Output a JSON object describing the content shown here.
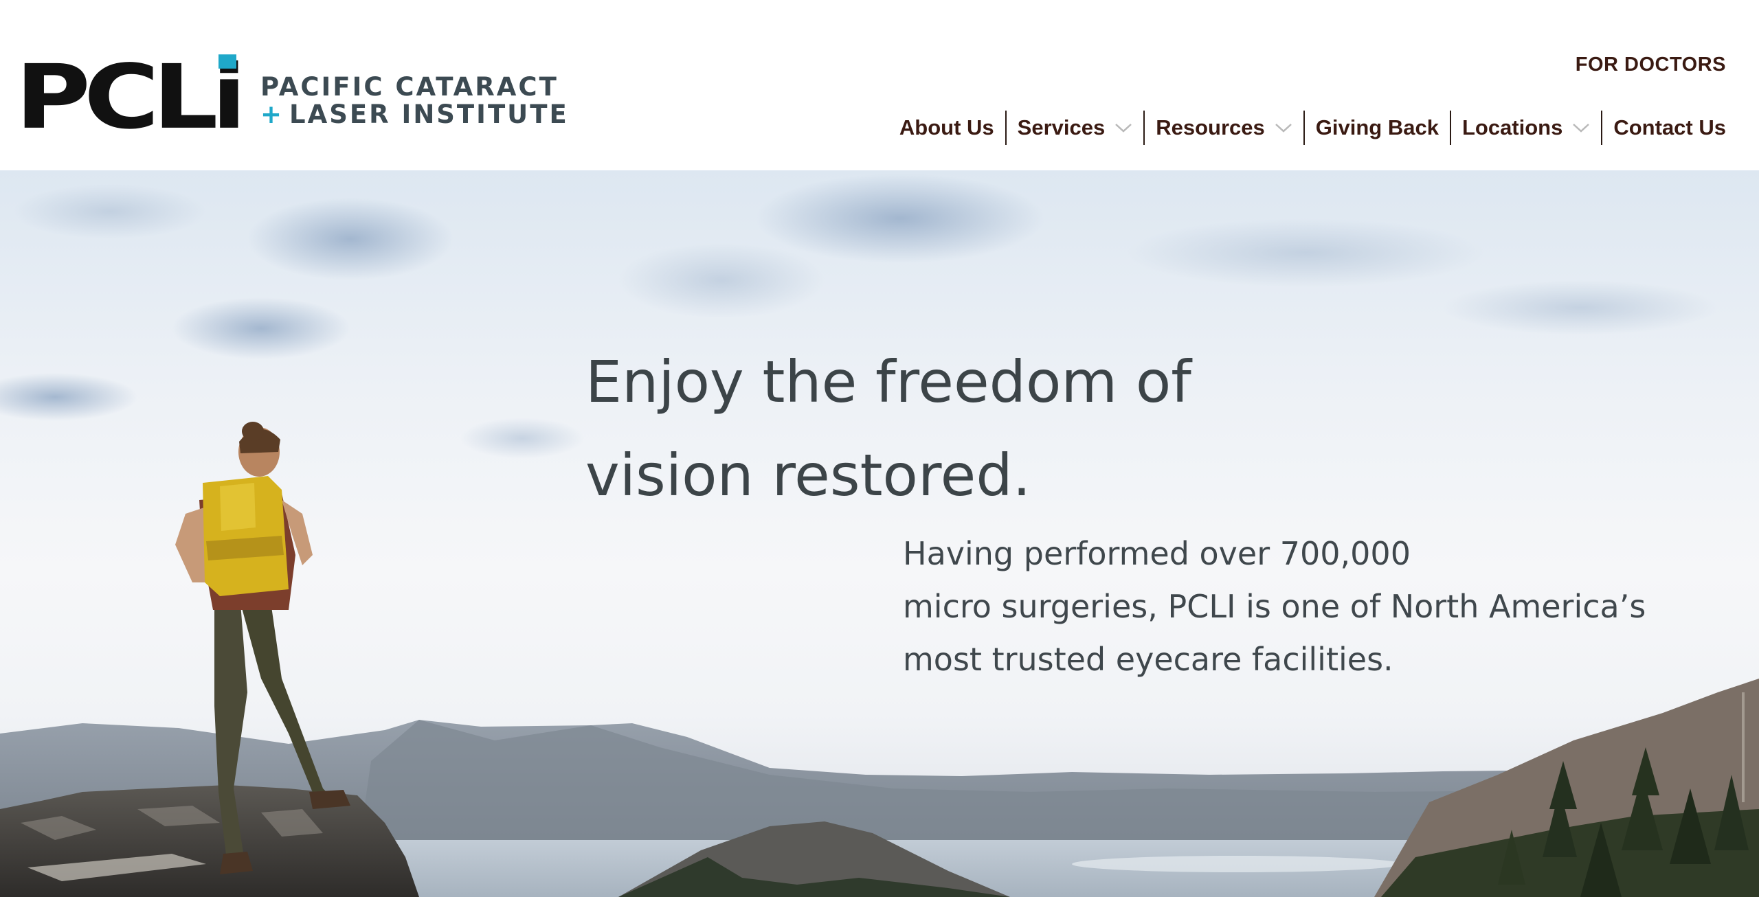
{
  "logo": {
    "mark": "PCLi",
    "line1": "PACIFIC CATARACT",
    "plus": "+",
    "line2": "LASER INSTITUTE",
    "accent_color": "#1fa8c9"
  },
  "utility_link": "FOR DOCTORS",
  "nav": {
    "items": [
      {
        "label": "About Us",
        "has_dropdown": false
      },
      {
        "label": "Services",
        "has_dropdown": true
      },
      {
        "label": "Resources",
        "has_dropdown": true
      },
      {
        "label": "Giving Back",
        "has_dropdown": false
      },
      {
        "label": "Locations",
        "has_dropdown": true
      },
      {
        "label": "Contact Us",
        "has_dropdown": false
      }
    ],
    "dropdown_icon": "chevron-down-icon",
    "text_color": "#3a1a12"
  },
  "hero": {
    "headline_line1": "Enjoy the freedom of",
    "headline_line2": "vision restored.",
    "sub_line1": "Having performed over 700,000",
    "sub_line2": "micro surgeries, PCLI is one of North America’s",
    "sub_line3": "most trusted eyecare facilities.",
    "image_subject": "hiker-on-rock-overlooking-lake"
  }
}
